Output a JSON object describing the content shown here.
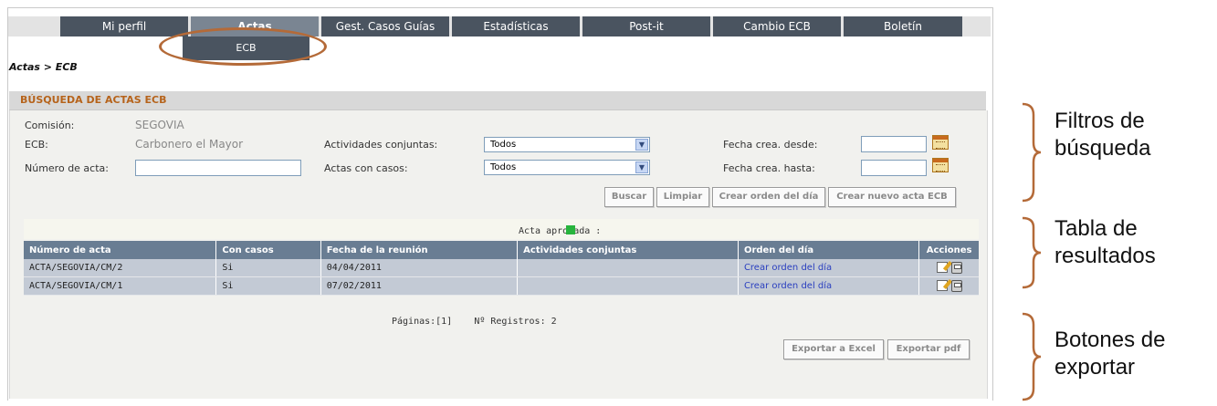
{
  "menu": {
    "tabs": [
      {
        "label": "Mi perfil"
      },
      {
        "label": "Actas"
      },
      {
        "label": "Gest. Casos Guías"
      },
      {
        "label": "Estadísticas"
      },
      {
        "label": "Post-it"
      },
      {
        "label": "Cambio ECB"
      },
      {
        "label": "Boletín"
      }
    ],
    "submenu_item": "ECB"
  },
  "breadcrumb": "Actas > ECB",
  "search": {
    "title": "BÚSQUEDA DE ACTAS ECB",
    "comision_label": "Comisión:",
    "comision_value": "SEGOVIA",
    "ecb_label": "ECB:",
    "ecb_value": "Carbonero el Mayor",
    "numero_label": "Número de acta:",
    "numero_value": "",
    "actividades_label": "Actividades conjuntas:",
    "actividades_value": "Todos",
    "casos_label": "Actas con casos:",
    "casos_value": "Todos",
    "fecha_desde_label": "Fecha crea. desde:",
    "fecha_desde_value": "",
    "fecha_hasta_label": "Fecha crea. hasta:",
    "fecha_hasta_value": ""
  },
  "buttons": {
    "buscar": "Buscar",
    "limpiar": "Limpiar",
    "crear_orden": "Crear orden del día",
    "crear_acta": "Crear nuevo acta ECB",
    "exportar_excel": "Exportar a Excel",
    "exportar_pdf": "Exportar pdf"
  },
  "legend": {
    "text": "Acta aprobada :",
    "color": "#27b43d"
  },
  "table": {
    "headers": [
      "Número de acta",
      "Con casos",
      "Fecha de la reunión",
      "Actividades conjuntas",
      "Orden del día",
      "Acciones"
    ],
    "rows": [
      {
        "numero": "ACTA/SEGOVIA/CM/2",
        "casos": "Si",
        "fecha": "04/04/2011",
        "actividades": "",
        "orden": "Crear orden del día"
      },
      {
        "numero": "ACTA/SEGOVIA/CM/1",
        "casos": "Si",
        "fecha": "07/02/2011",
        "actividades": "",
        "orden": "Crear orden del día"
      }
    ]
  },
  "pagination": {
    "pages": "Páginas:[1]",
    "records": "Nº Registros: 2"
  },
  "annotations": {
    "filtros_line1": "Filtros de",
    "filtros_line2": "búsqueda",
    "tabla_line1": "Tabla de",
    "tabla_line2": "resultados",
    "botones_line1": "Botones de",
    "botones_line2": "exportar"
  },
  "colors": {
    "accent_title": "#b6631b",
    "menu_bg": "#4a5460",
    "highlight_oval": "#b46a38",
    "table_header": "#697d93"
  }
}
